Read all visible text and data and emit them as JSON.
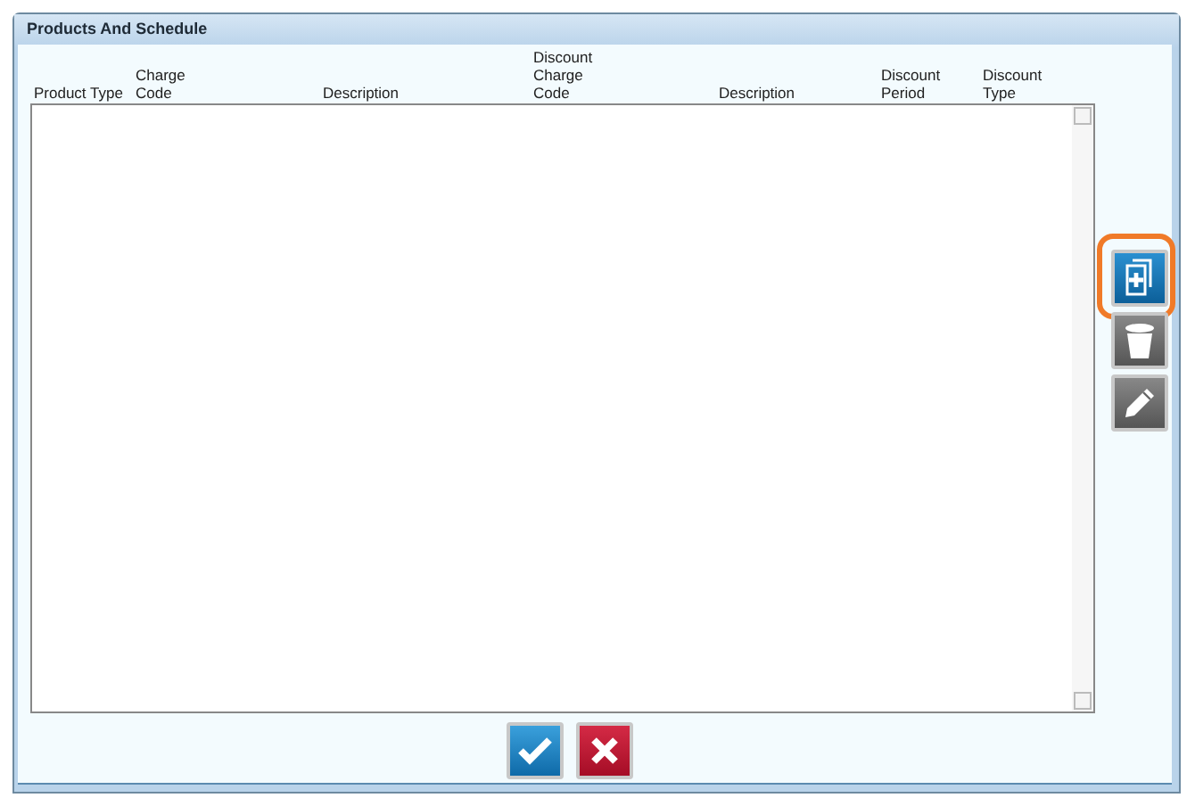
{
  "window": {
    "title": "Products And Schedule"
  },
  "table": {
    "columns": [
      {
        "label": "Product Type"
      },
      {
        "label": "Charge\nCode"
      },
      {
        "label": "Description"
      },
      {
        "label": "Discount\nCharge\nCode"
      },
      {
        "label": "Description"
      },
      {
        "label": "Discount\nPeriod"
      },
      {
        "label": "Discount\nType"
      }
    ]
  },
  "side_buttons": [
    {
      "kind": "add",
      "highlighted": true
    },
    {
      "kind": "delete",
      "highlighted": false
    },
    {
      "kind": "edit",
      "highlighted": false
    }
  ],
  "footer_buttons": [
    {
      "kind": "ok"
    },
    {
      "kind": "cancel"
    }
  ]
}
